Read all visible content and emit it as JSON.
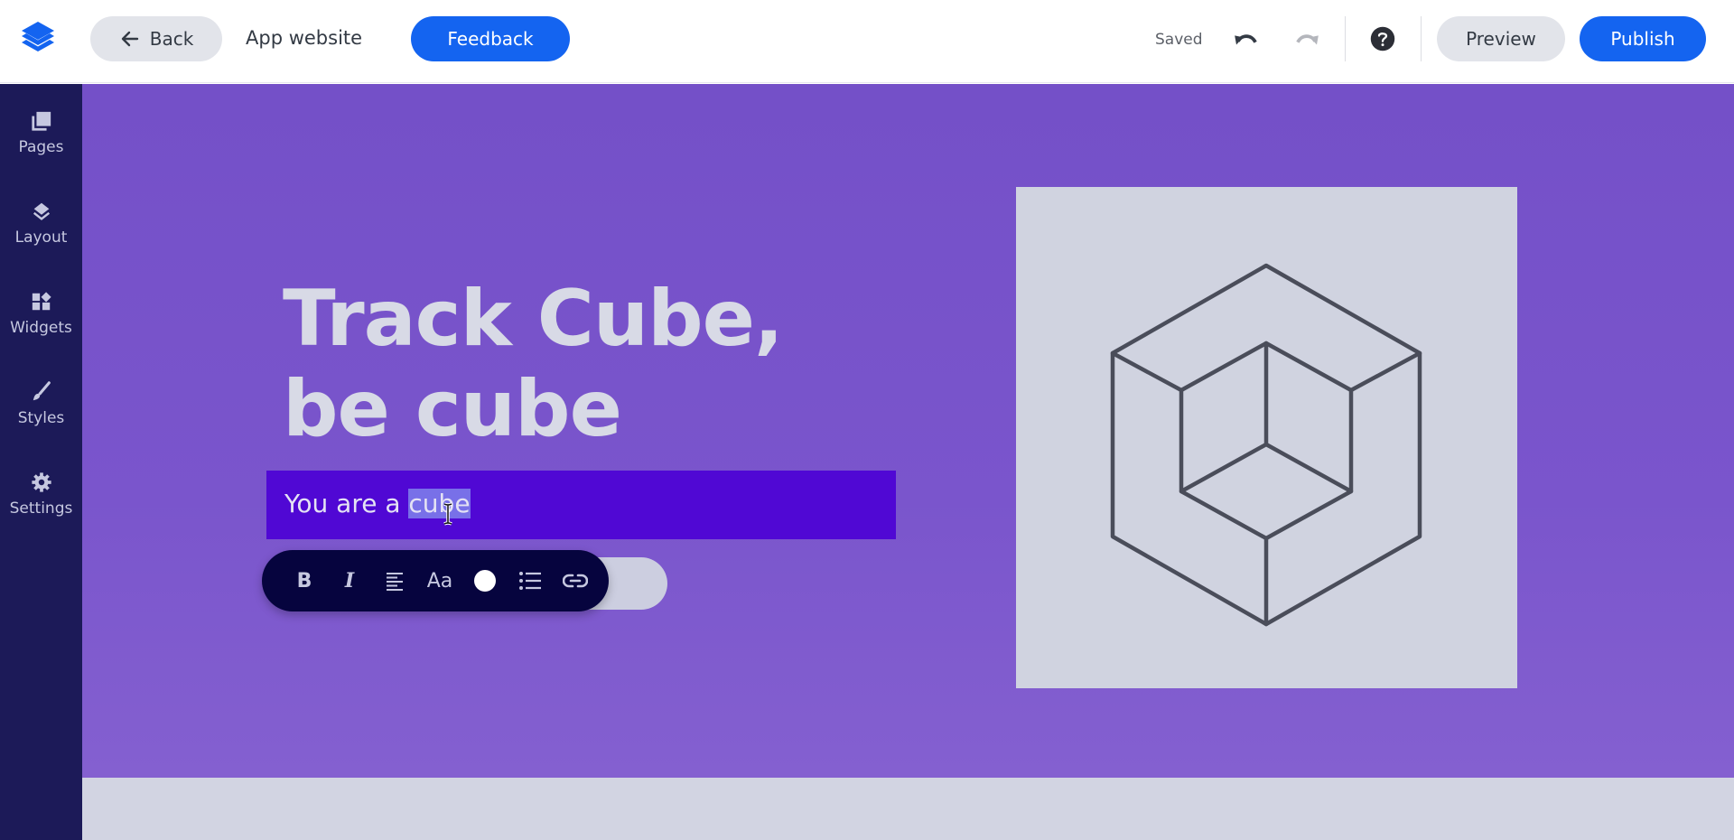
{
  "topbar": {
    "logo": "layers-logo-icon",
    "back_label": "Back",
    "app_title": "App website",
    "feedback_label": "Feedback",
    "save_status": "Saved",
    "undo_icon": "undo-icon",
    "redo_icon": "redo-icon",
    "help_icon": "help-icon",
    "preview_label": "Preview",
    "publish_label": "Publish"
  },
  "sidebar": {
    "items": [
      {
        "label": "Pages",
        "icon": "pages-icon"
      },
      {
        "label": "Layout",
        "icon": "layers-icon"
      },
      {
        "label": "Widgets",
        "icon": "widgets-icon"
      },
      {
        "label": "Styles",
        "icon": "brush-icon"
      },
      {
        "label": "Settings",
        "icon": "gear-icon"
      }
    ]
  },
  "canvas": {
    "headline_line1": "Track Cube,",
    "headline_line2": "be cube",
    "subtitle_before": "You are a ",
    "subtitle_selected": "cube",
    "format_toolbar": {
      "bold": "B",
      "italic": "I",
      "align": "align-left-icon",
      "font_size": "Aa",
      "color": "#ffffff",
      "list": "bullet-list-icon",
      "link": "link-icon"
    },
    "image_alt": "cube-illustration"
  },
  "colors": {
    "accent": "#1464f0",
    "sidebar_bg": "#1c1a58",
    "hero_bg": "#7450c8",
    "subtitle_bg": "#5008d4",
    "toolbar_bg": "#06043e"
  }
}
